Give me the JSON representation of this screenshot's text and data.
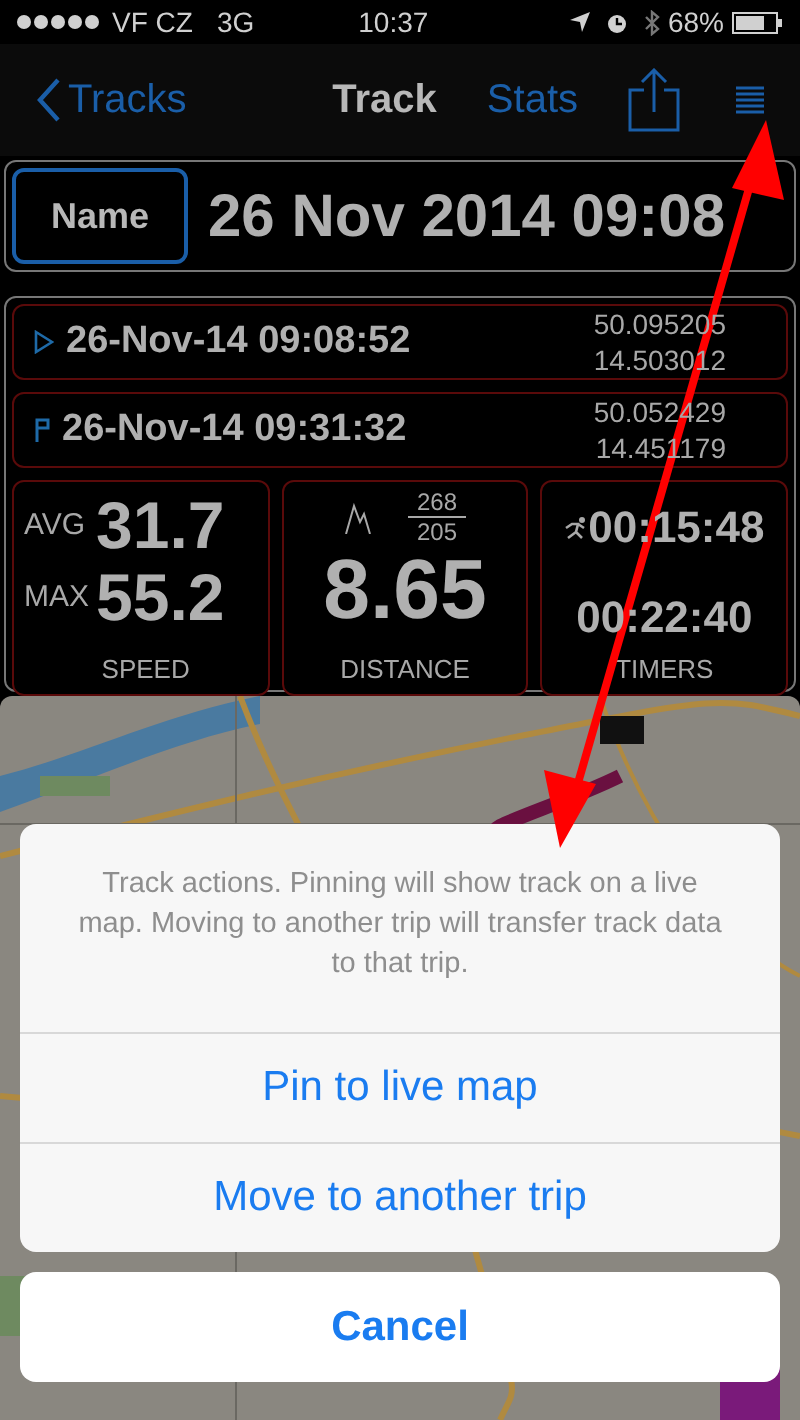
{
  "status_bar": {
    "carrier": "VF CZ",
    "network": "3G",
    "time": "10:37",
    "battery": "68%"
  },
  "nav": {
    "back": "Tracks",
    "title": "Track",
    "stats": "Stats"
  },
  "name": {
    "button": "Name",
    "value": "26 Nov 2014 09:08"
  },
  "points": [
    {
      "kind": "start",
      "time": "26-Nov-14 09:08:52",
      "lat": "50.095205",
      "lon": "14.503012"
    },
    {
      "kind": "finish",
      "time": "26-Nov-14 09:31:32",
      "lat": "50.052429",
      "lon": "14.451179"
    }
  ],
  "speed": {
    "avg_label": "AVG",
    "avg": "31.7",
    "max_label": "MAX",
    "max": "55.2",
    "caption": "SPEED"
  },
  "distance": {
    "ascent": "268",
    "descent": "205",
    "value": "8.65",
    "caption": "DISTANCE"
  },
  "timers": {
    "moving": "00:15:48",
    "total": "00:22:40",
    "caption": "TIMERS"
  },
  "action_sheet": {
    "message": "Track actions. Pinning will show track on a live map. Moving to another trip will transfer track data to that trip.",
    "actions": [
      "Pin to live map",
      "Move to another trip"
    ],
    "cancel": "Cancel"
  }
}
